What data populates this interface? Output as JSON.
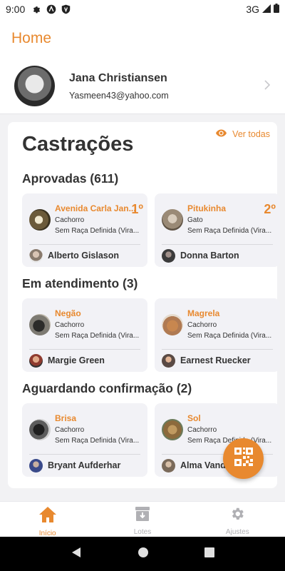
{
  "status_bar": {
    "time": "9:00",
    "network": "3G"
  },
  "header": {
    "title": "Home"
  },
  "profile": {
    "name": "Jana Christiansen",
    "email": "Yasmeen43@yahoo.com"
  },
  "castracoes": {
    "title": "Castrações",
    "see_all": "Ver todas",
    "groups": [
      {
        "title": "Aprovadas (611)",
        "cards": [
          {
            "pet_name": "Avenida Carla Jan...",
            "species": "Cachorro",
            "breed": "Sem Raça Definida (Vira...",
            "rank": "1º",
            "owner": "Alberto Gislason",
            "photo_color": "#6b5a3a",
            "owner_color": "#8a7b6e"
          },
          {
            "pet_name": "Pitukinha",
            "species": "Gato",
            "breed": "Sem Raça Definida (Vira...",
            "rank": "2º",
            "owner": "Donna Barton",
            "photo_color": "#9a8a76",
            "owner_color": "#3b3b3b"
          }
        ]
      },
      {
        "title": "Em atendimento (3)",
        "cards": [
          {
            "pet_name": "Negão",
            "species": "Cachorro",
            "breed": "Sem Raça Definida (Vira...",
            "rank": "",
            "owner": "Margie Green",
            "photo_color": "#4d4d4a",
            "owner_color": "#8f3b2f"
          },
          {
            "pet_name": "Magrela",
            "species": "Cachorro",
            "breed": "Sem Raça Definida (Vira...",
            "rank": "",
            "owner": "Earnest Ruecker",
            "photo_color": "#b07a52",
            "owner_color": "#5a4a44"
          }
        ]
      },
      {
        "title": "Aguardando confirmação (2)",
        "cards": [
          {
            "pet_name": "Brisa",
            "species": "Cachorro",
            "breed": "Sem Raça Definida (Vira...",
            "rank": "",
            "owner": "Bryant Aufderhar",
            "photo_color": "#3c3c3c",
            "owner_color": "#3a4a8a"
          },
          {
            "pet_name": "Sol",
            "species": "Cachorro",
            "breed": "Sem Raça Definida (Vira...",
            "rank": "",
            "owner": "Alma Vandervort",
            "photo_color": "#8c6a3c",
            "owner_color": "#7a6a5a"
          }
        ]
      }
    ]
  },
  "bottom_nav": [
    {
      "label": "Início",
      "icon": "home-icon",
      "active": true
    },
    {
      "label": "Lotes",
      "icon": "archive-icon",
      "active": false
    },
    {
      "label": "Ajustes",
      "icon": "gear-icon",
      "active": false
    }
  ],
  "colors": {
    "accent": "#e8892f",
    "card_bg": "#f2f2f6"
  }
}
